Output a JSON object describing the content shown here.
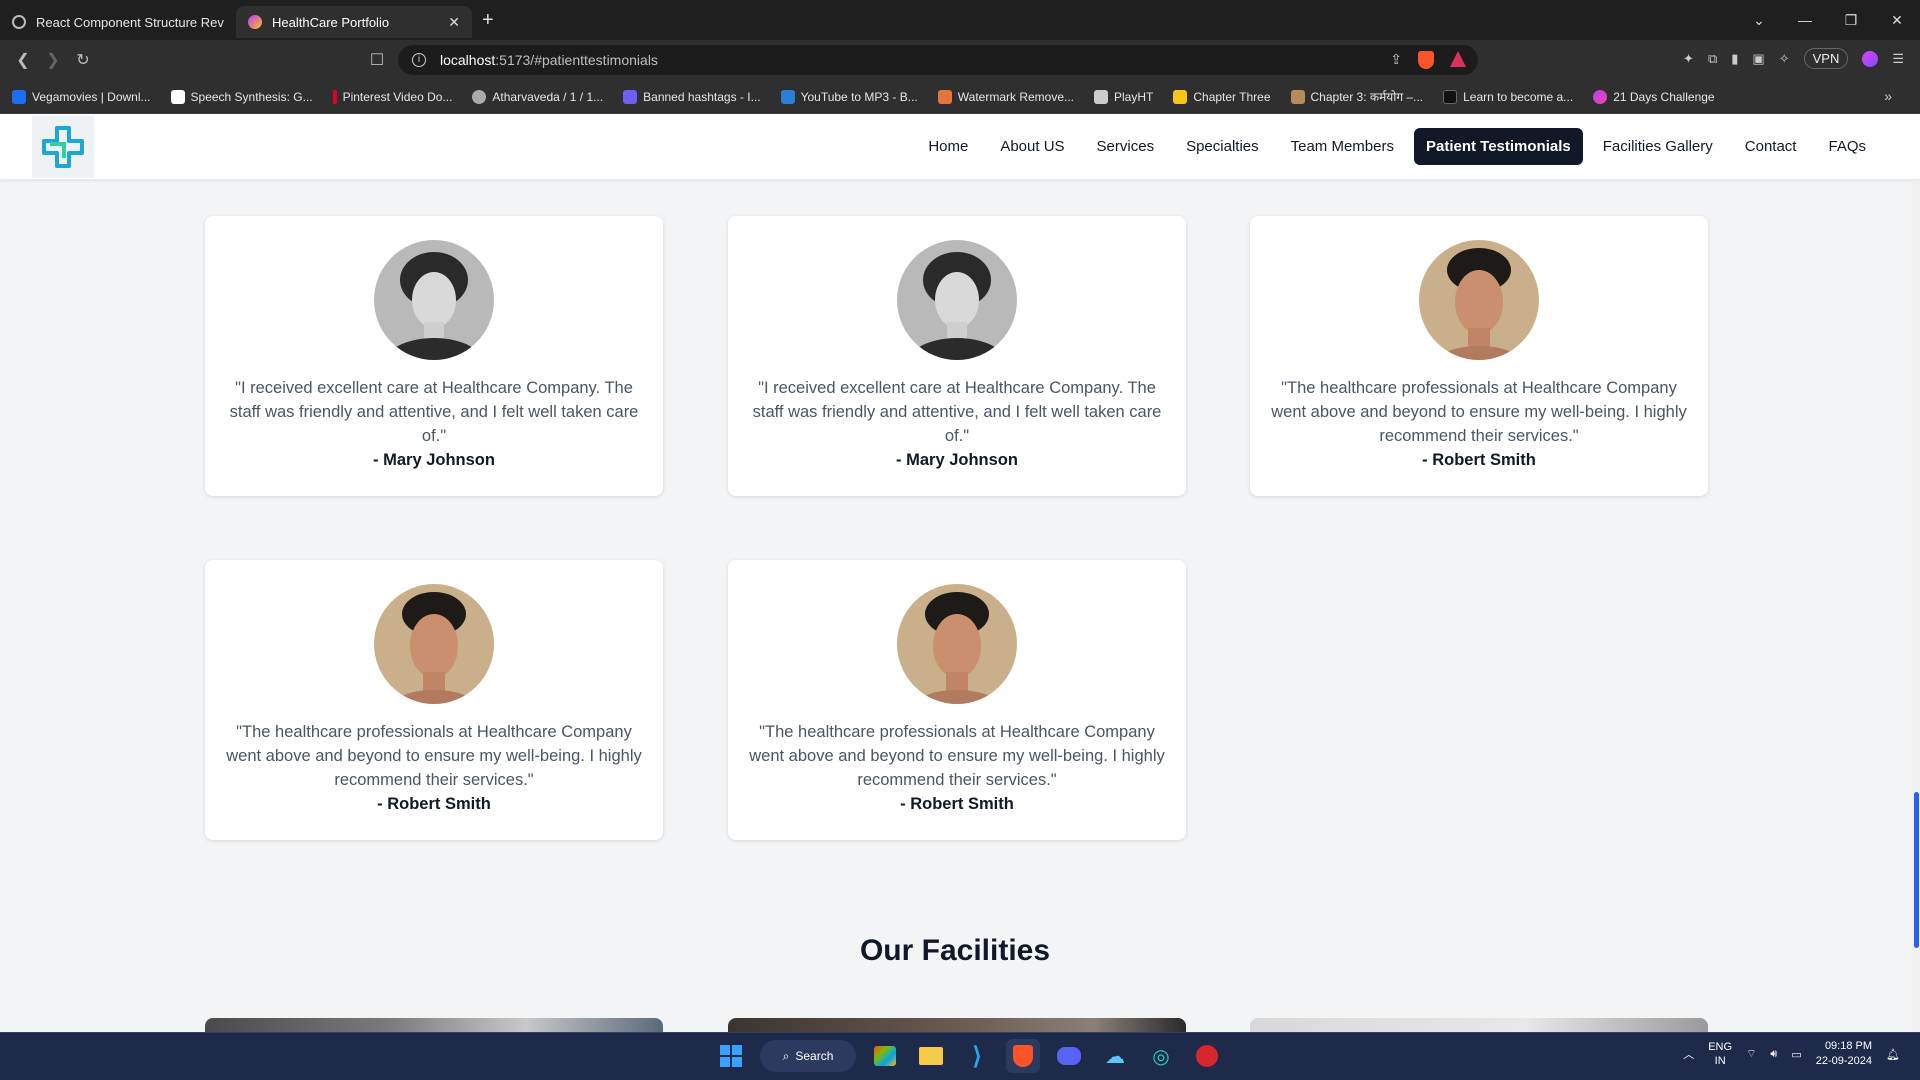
{
  "browser": {
    "tabs": [
      {
        "label": "React Component Structure Review",
        "active": false
      },
      {
        "label": "HealthCare Portfolio",
        "active": true
      }
    ],
    "url_host": "localhost",
    "url_path": ":5173/#patienttestimonials",
    "vpn_label": "VPN",
    "bookmarks": [
      "Vegamovies | Downl...",
      "Speech Synthesis: G...",
      "Pinterest Video Do...",
      "Atharvaveda / 1 / 1...",
      "Banned hashtags - I...",
      "YouTube to MP3 - B...",
      "Watermark Remove...",
      "PlayHT",
      "Chapter Three",
      "Chapter 3: कर्मयोग –...",
      "Learn to become a...",
      "21 Days Challenge"
    ]
  },
  "nav": {
    "items": [
      "Home",
      "About US",
      "Services",
      "Specialties",
      "Team Members",
      "Patient Testimonials",
      "Facilities Gallery",
      "Contact",
      "FAQs"
    ],
    "active": "Patient Testimonials"
  },
  "testimonials": [
    {
      "quote": "\"I received excellent care at Healthcare Company. The staff was friendly and attentive, and I felt well taken care of.\"",
      "author": "- Mary Johnson",
      "avatar": "young man with curly hair, grayscale"
    },
    {
      "quote": "\"I received excellent care at Healthcare Company. The staff was friendly and attentive, and I felt well taken care of.\"",
      "author": "- Mary Johnson",
      "avatar": "young man with curly hair, grayscale"
    },
    {
      "quote": "\"The healthcare professionals at Healthcare Company went above and beyond to ensure my well-being. I highly recommend their services.\"",
      "author": "- Robert Smith",
      "avatar": "young man with dark hair, beige background"
    },
    {
      "quote": "\"The healthcare professionals at Healthcare Company went above and beyond to ensure my well-being. I highly recommend their services.\"",
      "author": "- Robert Smith",
      "avatar": "young man with dark hair, beige background"
    },
    {
      "quote": "\"The healthcare professionals at Healthcare Company went above and beyond to ensure my well-being. I highly recommend their services.\"",
      "author": "- Robert Smith",
      "avatar": "young man with dark hair, beige background"
    }
  ],
  "facilities": {
    "title": "Our Facilities"
  },
  "taskbar": {
    "search_label": "Search",
    "lang_1": "ENG",
    "lang_2": "IN",
    "time": "09:18 PM",
    "date": "22-09-2024"
  },
  "colors": {
    "accent": "#111827",
    "scroll": "#2563eb"
  }
}
